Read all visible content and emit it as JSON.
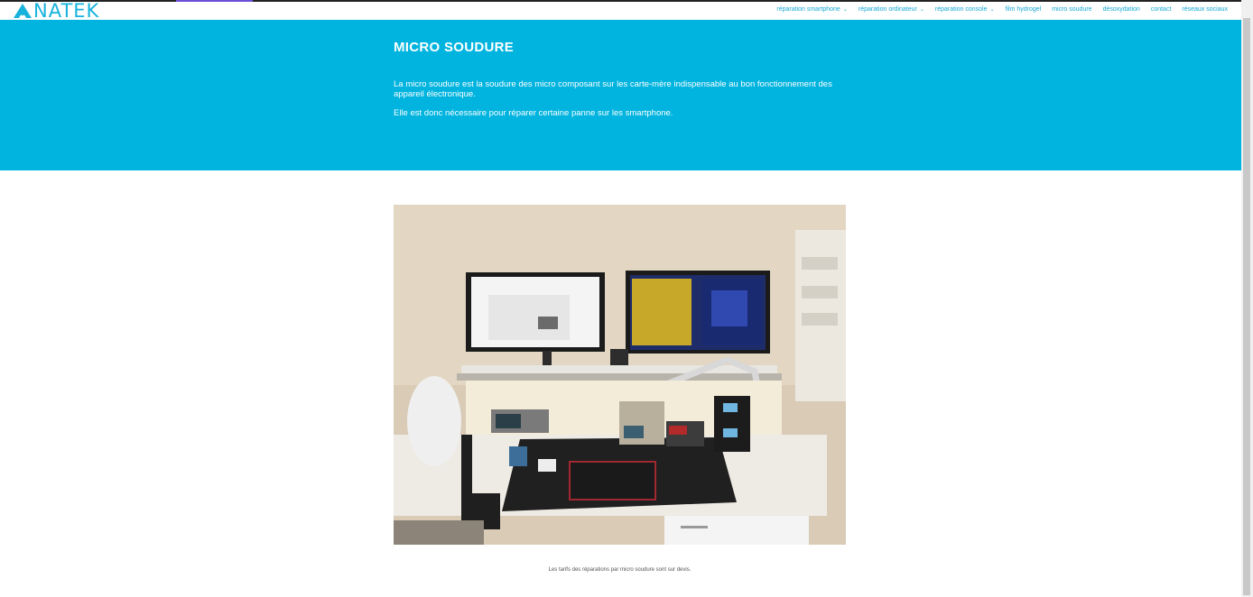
{
  "brand": {
    "logo_text": "NATEK",
    "accent": "#17b3dc"
  },
  "nav": {
    "items": [
      {
        "label": "réparation smartphone",
        "has_dropdown": true
      },
      {
        "label": "réparation ordinateur",
        "has_dropdown": true
      },
      {
        "label": "réparation console",
        "has_dropdown": true
      },
      {
        "label": "film hydrogel",
        "has_dropdown": false
      },
      {
        "label": "micro soudure",
        "has_dropdown": false
      },
      {
        "label": "désoxydation",
        "has_dropdown": false
      },
      {
        "label": "contact",
        "has_dropdown": false
      },
      {
        "label": "réseaux sociaux",
        "has_dropdown": false
      }
    ]
  },
  "hero": {
    "title": "MICRO SOUDURE",
    "paragraph1": "La micro soudure est la soudure des micro composant sur les carte-mère indispensable au bon fonctionnement des appareil électronique.",
    "paragraph2": "Elle est donc nécessaire pour réparer certaine panne sur les smartphone.",
    "background": "#00b4df"
  },
  "main": {
    "caption": "Les tarifs des réparations par micro soudure sont sur devis."
  }
}
